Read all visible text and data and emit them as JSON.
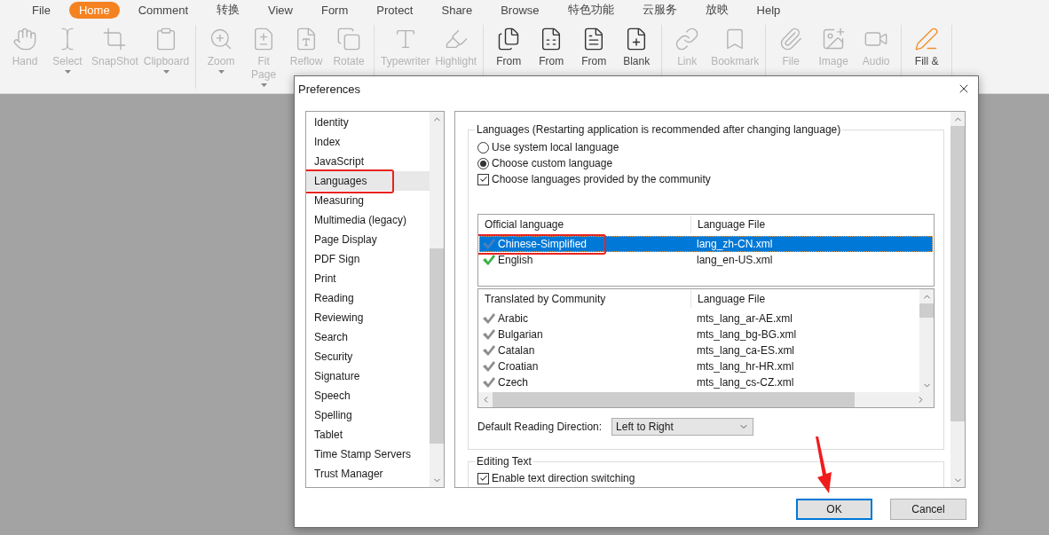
{
  "menu_tabs": [
    {
      "label": "File",
      "selected": false
    },
    {
      "label": "Home",
      "selected": true
    },
    {
      "label": "Comment",
      "selected": false
    },
    {
      "label": "转换",
      "selected": false
    },
    {
      "label": "View",
      "selected": false
    },
    {
      "label": "Form",
      "selected": false
    },
    {
      "label": "Protect",
      "selected": false
    },
    {
      "label": "Share",
      "selected": false
    },
    {
      "label": "Browse",
      "selected": false
    },
    {
      "label": "特色功能",
      "selected": false
    },
    {
      "label": "云服务",
      "selected": false
    },
    {
      "label": "放映",
      "selected": false
    },
    {
      "label": "Help",
      "selected": false
    }
  ],
  "toolbar_groups": [
    {
      "items": [
        {
          "label": "Hand",
          "disabled": true,
          "dropdown": false
        },
        {
          "label": "Select",
          "disabled": true,
          "dropdown": true
        },
        {
          "label": "SnapShot",
          "disabled": true,
          "dropdown": false
        },
        {
          "label": "Clipboard",
          "disabled": true,
          "dropdown": true
        }
      ]
    },
    {
      "items": [
        {
          "label": "Zoom",
          "disabled": true,
          "dropdown": true
        },
        {
          "label": "Fit\nPage",
          "disabled": true,
          "dropdown": true
        },
        {
          "label": "Reflow",
          "disabled": true,
          "dropdown": false
        },
        {
          "label": "Rotate",
          "disabled": true,
          "dropdown": false
        }
      ]
    },
    {
      "items": [
        {
          "label": "Typewriter",
          "disabled": true,
          "dropdown": false
        },
        {
          "label": "Highlight",
          "disabled": true,
          "dropdown": false
        }
      ]
    },
    {
      "items": [
        {
          "label": "From",
          "disabled": false,
          "dropdown": false
        },
        {
          "label": "From",
          "disabled": false,
          "dropdown": false
        },
        {
          "label": "From",
          "disabled": false,
          "dropdown": false
        },
        {
          "label": "Blank",
          "disabled": false,
          "dropdown": false
        }
      ]
    },
    {
      "items": [
        {
          "label": "Link",
          "disabled": true,
          "dropdown": false
        },
        {
          "label": "Bookmark",
          "disabled": true,
          "dropdown": false
        }
      ]
    },
    {
      "items": [
        {
          "label": "File",
          "disabled": true,
          "dropdown": false
        },
        {
          "label": "Image",
          "disabled": true,
          "dropdown": false
        },
        {
          "label": "Audio",
          "disabled": true,
          "dropdown": false
        }
      ]
    },
    {
      "items": [
        {
          "label": "Fill &",
          "disabled": false,
          "dropdown": false
        }
      ]
    }
  ],
  "dialog": {
    "title": "Preferences",
    "categories": [
      {
        "label": "Identity",
        "selected": false,
        "annotated": false
      },
      {
        "label": "Index",
        "selected": false,
        "annotated": false
      },
      {
        "label": "JavaScript",
        "selected": false,
        "annotated": false
      },
      {
        "label": "Languages",
        "selected": true,
        "annotated": true
      },
      {
        "label": "Measuring",
        "selected": false,
        "annotated": false
      },
      {
        "label": "Multimedia (legacy)",
        "selected": false,
        "annotated": false
      },
      {
        "label": "Page Display",
        "selected": false,
        "annotated": false
      },
      {
        "label": "PDF Sign",
        "selected": false,
        "annotated": false
      },
      {
        "label": "Print",
        "selected": false,
        "annotated": false
      },
      {
        "label": "Reading",
        "selected": false,
        "annotated": false
      },
      {
        "label": "Reviewing",
        "selected": false,
        "annotated": false
      },
      {
        "label": "Search",
        "selected": false,
        "annotated": false
      },
      {
        "label": "Security",
        "selected": false,
        "annotated": false
      },
      {
        "label": "Signature",
        "selected": false,
        "annotated": false
      },
      {
        "label": "Speech",
        "selected": false,
        "annotated": false
      },
      {
        "label": "Spelling",
        "selected": false,
        "annotated": false
      },
      {
        "label": "Tablet",
        "selected": false,
        "annotated": false
      },
      {
        "label": "Time Stamp Servers",
        "selected": false,
        "annotated": false
      },
      {
        "label": "Trust Manager",
        "selected": false,
        "annotated": false
      }
    ],
    "languages_group": {
      "title": "Languages (Restarting application is recommended after changing language)",
      "options": [
        {
          "kind": "radio",
          "label": "Use system local language",
          "checked": false
        },
        {
          "kind": "radio",
          "label": "Choose custom language",
          "checked": true
        },
        {
          "kind": "checkbox",
          "label": "Choose languages provided by the community",
          "checked": true
        }
      ],
      "official_table": {
        "columns": [
          "Official language",
          "Language File"
        ],
        "rows": [
          {
            "language": "Chinese-Simplified",
            "file": "lang_zh-CN.xml",
            "selected": true,
            "annotated": true,
            "color": "#4a7fc1"
          },
          {
            "language": "English",
            "file": "lang_en-US.xml",
            "selected": false,
            "annotated": false,
            "color": "#3cb043"
          }
        ]
      },
      "community_table": {
        "columns": [
          "Translated by Community",
          "Language File"
        ],
        "rows": [
          {
            "language": "Arabic",
            "file": "mts_lang_ar-AE.xml"
          },
          {
            "language": "Bulgarian",
            "file": "mts_lang_bg-BG.xml"
          },
          {
            "language": "Catalan",
            "file": "mts_lang_ca-ES.xml"
          },
          {
            "language": "Croatian",
            "file": "mts_lang_hr-HR.xml"
          },
          {
            "language": "Czech",
            "file": "mts_lang_cs-CZ.xml"
          }
        ]
      },
      "reading_direction": {
        "label": "Default Reading Direction:",
        "value": "Left to Right"
      }
    },
    "editing_group": {
      "title": "Editing Text",
      "options": [
        {
          "kind": "checkbox",
          "label": "Enable text direction switching",
          "checked": true
        }
      ]
    },
    "buttons": [
      {
        "label": "OK",
        "default": true,
        "annotated": true
      },
      {
        "label": "Cancel",
        "default": false,
        "annotated": false
      }
    ]
  }
}
